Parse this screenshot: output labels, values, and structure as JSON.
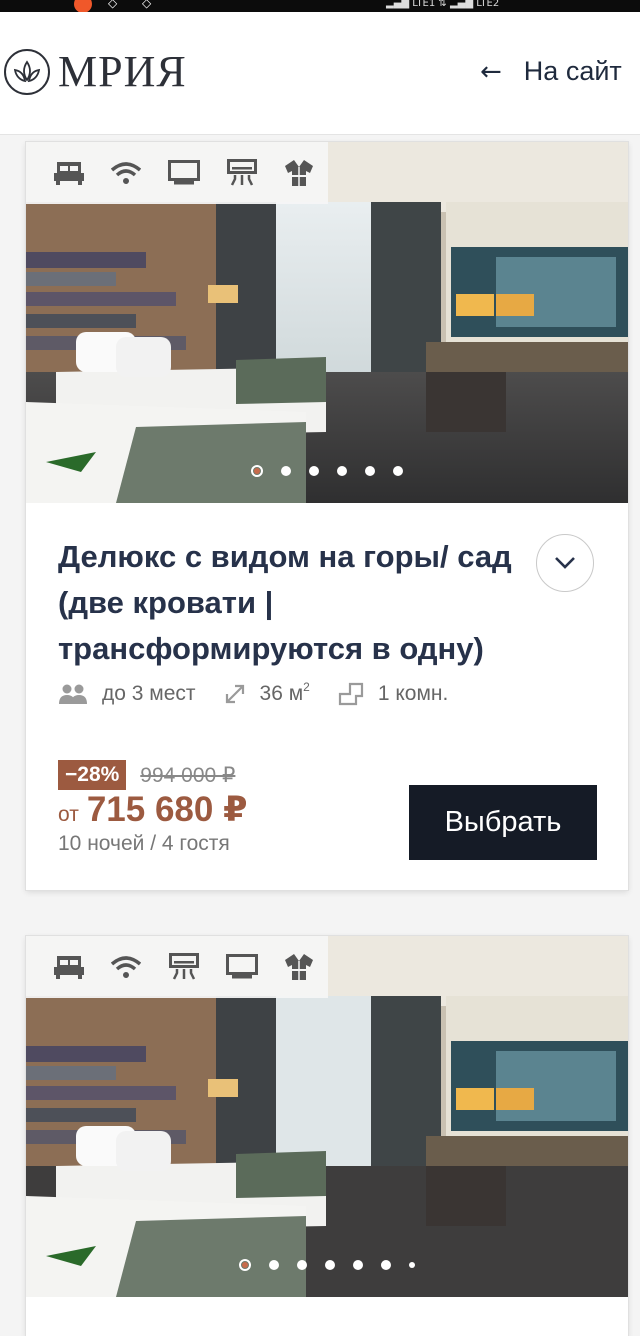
{
  "header": {
    "logo_text": "МРИЯ",
    "back_link_label": "На сайт"
  },
  "rooms": [
    {
      "title": "Делюкс с видом на горы/ сад (две кровати | трансформируются в одну)",
      "amenities": [
        "bed-icon",
        "wifi-icon",
        "tv-icon",
        "air-conditioner-icon",
        "bathrobe-icon"
      ],
      "photo_count": 6,
      "active_photo": 1,
      "specs": {
        "guests": "до 3 мест",
        "area_value": "36 м",
        "area_unit_sup": "2",
        "rooms": "1 комн."
      },
      "discount": "−28%",
      "old_price": "994 000 ₽",
      "price_prefix": "от",
      "price": "715 680 ₽",
      "nights_guests": "10 ночей / 4 гостя",
      "choose_label": "Выбрать"
    },
    {
      "amenities": [
        "bed-icon",
        "wifi-icon",
        "air-conditioner-icon",
        "tv-icon",
        "bathrobe-icon"
      ],
      "photo_count": 7,
      "active_photo": 1
    }
  ],
  "colors": {
    "accent_price": "#9c5a40",
    "button_bg": "#151b26",
    "title": "#27324a"
  }
}
